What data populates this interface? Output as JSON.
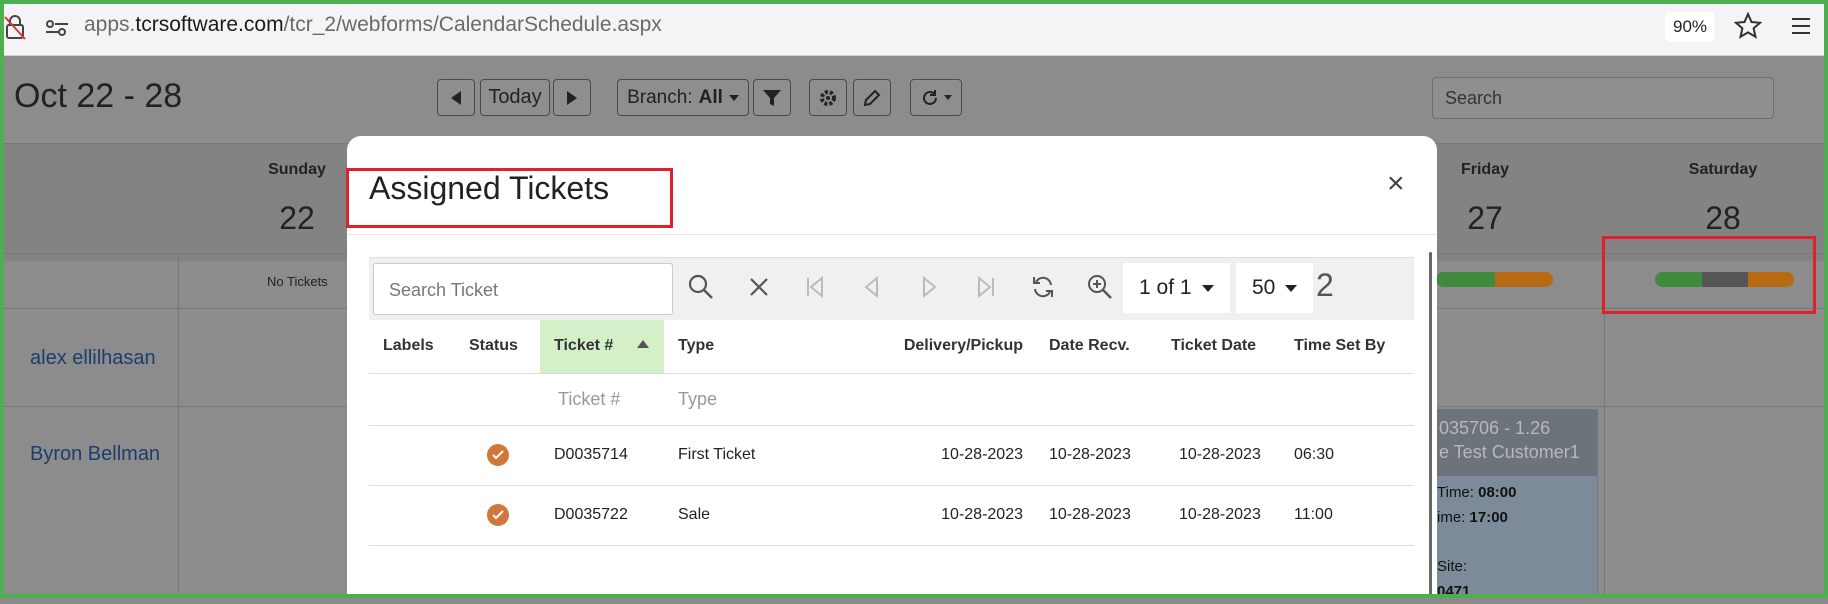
{
  "browser": {
    "url_prefix": "apps.",
    "url_domain": "tcrsoftware.com",
    "url_path": "/tcr_2/webforms/CalendarSchedule.aspx",
    "zoom": "90%"
  },
  "calendar": {
    "date_range": "Oct 22 - 28",
    "today_label": "Today",
    "branch_label": "Branch:",
    "branch_value": "All",
    "search_placeholder": "Search",
    "days": [
      {
        "name": "Sunday",
        "num": "22"
      },
      {
        "name": "Friday",
        "num": "27"
      },
      {
        "name": "Saturday",
        "num": "28"
      }
    ],
    "no_tickets": "No Tickets",
    "people": [
      "alex ellilhasan",
      "Byron Bellman"
    ],
    "card": {
      "line1": "035706 - 1.26",
      "line2": "e Test Customer1",
      "time1_label": "Time:",
      "time1": "08:00",
      "time2_label": "ime:",
      "time2": "17:00",
      "site_label": "Site:",
      "site": "0471"
    },
    "colors": {
      "green": "#3f8a3c",
      "gray": "#555555",
      "orange": "#b86a12"
    }
  },
  "modal": {
    "title": "Assigned Tickets",
    "close": "×",
    "search_placeholder": "Search Ticket",
    "page": "1 of 1",
    "page_size": "50",
    "count": "2",
    "columns": [
      "Labels",
      "Status",
      "Ticket #",
      "Type",
      "Delivery/Pickup",
      "Date Recv.",
      "Ticket Date",
      "Time Set By"
    ],
    "filters": {
      "ticket": "Ticket #",
      "type": "Type"
    },
    "rows": [
      {
        "ticket": "D0035714",
        "type": "First Ticket",
        "delivery": "10-28-2023",
        "recv": "10-28-2023",
        "ticket_date": "10-28-2023",
        "time": "06:30",
        "status": "check-circle-icon"
      },
      {
        "ticket": "D0035722",
        "type": "Sale",
        "delivery": "10-28-2023",
        "recv": "10-28-2023",
        "ticket_date": "10-28-2023",
        "time": "11:00",
        "status": "check-circle-icon"
      }
    ]
  }
}
